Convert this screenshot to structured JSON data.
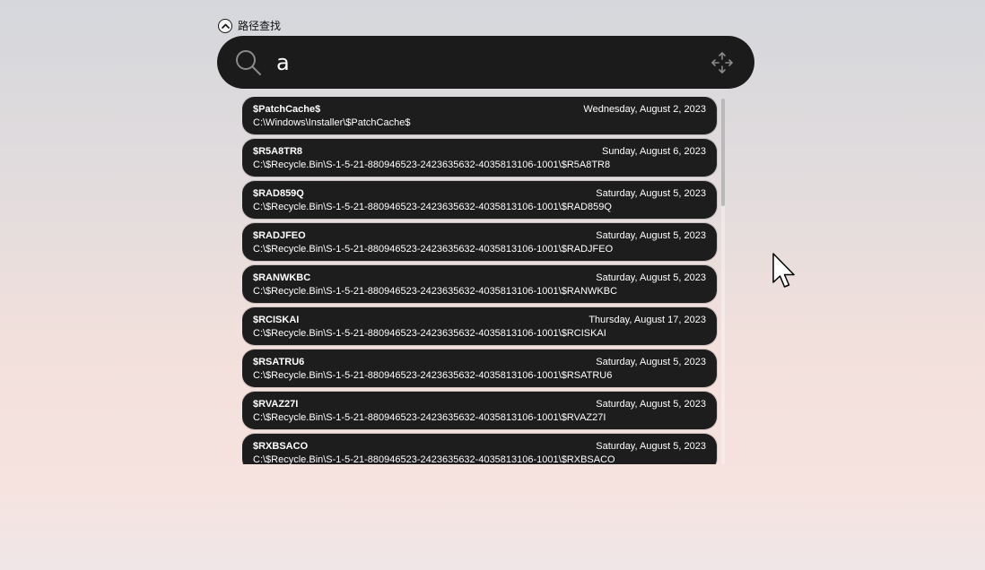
{
  "mode_toggle": {
    "label": "路径查找",
    "icon": "chevron-up-icon"
  },
  "search": {
    "value": "a",
    "search_icon": "search-icon",
    "move_icon": "move-icon"
  },
  "results": [
    {
      "name": "$PatchCache$",
      "date": "Wednesday, August 2, 2023",
      "path": "C:\\Windows\\Installer\\$PatchCache$"
    },
    {
      "name": "$R5A8TR8",
      "date": "Sunday, August 6, 2023",
      "path": "C:\\$Recycle.Bin\\S-1-5-21-880946523-2423635632-4035813106-1001\\$R5A8TR8"
    },
    {
      "name": "$RAD859Q",
      "date": "Saturday, August 5, 2023",
      "path": "C:\\$Recycle.Bin\\S-1-5-21-880946523-2423635632-4035813106-1001\\$RAD859Q"
    },
    {
      "name": "$RADJFEO",
      "date": "Saturday, August 5, 2023",
      "path": "C:\\$Recycle.Bin\\S-1-5-21-880946523-2423635632-4035813106-1001\\$RADJFEO"
    },
    {
      "name": "$RANWKBC",
      "date": "Saturday, August 5, 2023",
      "path": "C:\\$Recycle.Bin\\S-1-5-21-880946523-2423635632-4035813106-1001\\$RANWKBC"
    },
    {
      "name": "$RCISKAI",
      "date": "Thursday, August 17, 2023",
      "path": "C:\\$Recycle.Bin\\S-1-5-21-880946523-2423635632-4035813106-1001\\$RCISKAI"
    },
    {
      "name": "$RSATRU6",
      "date": "Saturday, August 5, 2023",
      "path": "C:\\$Recycle.Bin\\S-1-5-21-880946523-2423635632-4035813106-1001\\$RSATRU6"
    },
    {
      "name": "$RVAZ27I",
      "date": "Saturday, August 5, 2023",
      "path": "C:\\$Recycle.Bin\\S-1-5-21-880946523-2423635632-4035813106-1001\\$RVAZ27I"
    },
    {
      "name": "$RXBSACO",
      "date": "Saturday, August 5, 2023",
      "path": "C:\\$Recycle.Bin\\S-1-5-21-880946523-2423635632-4035813106-1001\\$RXBSACO"
    }
  ],
  "colors": {
    "bar_bg": "#1b1b1b",
    "item_bg": "#1d1d1d",
    "text": "#ffffff"
  }
}
